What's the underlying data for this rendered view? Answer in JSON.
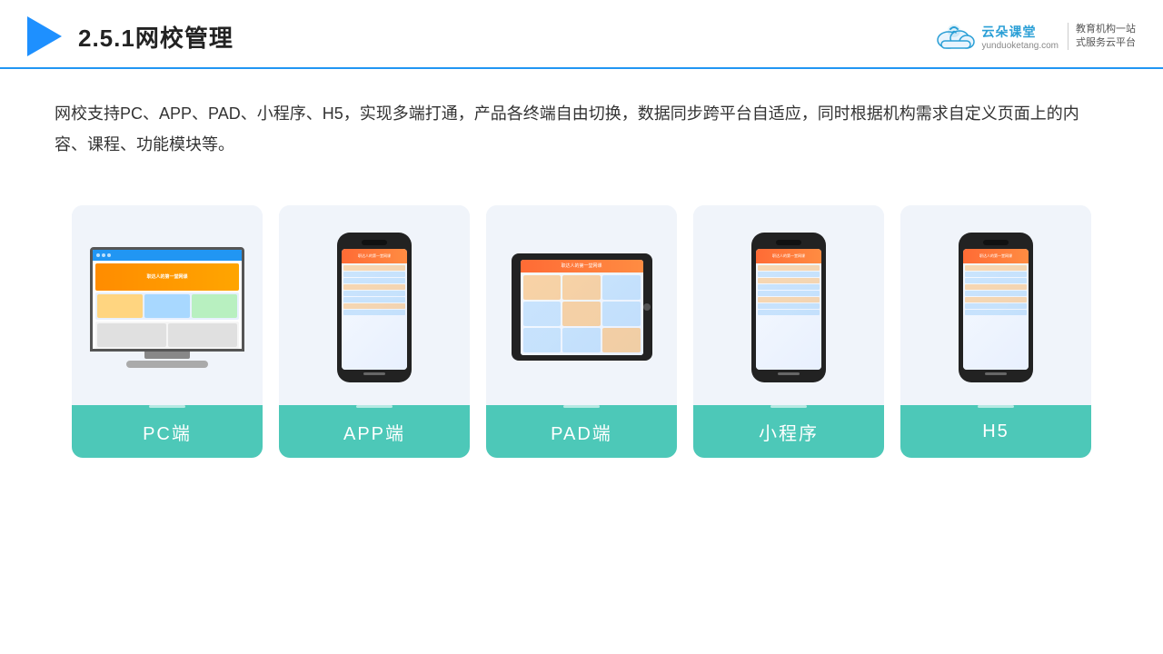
{
  "header": {
    "title": "2.5.1网校管理",
    "brand_name": "云朵课堂",
    "brand_url": "yunduoketang.com",
    "brand_slogan": "教育机构一站\n式服务云平台"
  },
  "description": {
    "text": "网校支持PC、APP、PAD、小程序、H5，实现多端打通，产品各终端自由切换，数据同步跨平台自适应，同时根据机构需求自定义页面上的内容、课程、功能模块等。"
  },
  "cards": [
    {
      "label": "PC端",
      "type": "pc"
    },
    {
      "label": "APP端",
      "type": "phone"
    },
    {
      "label": "PAD端",
      "type": "tablet"
    },
    {
      "label": "小程序",
      "type": "phone"
    },
    {
      "label": "H5",
      "type": "phone"
    }
  ]
}
